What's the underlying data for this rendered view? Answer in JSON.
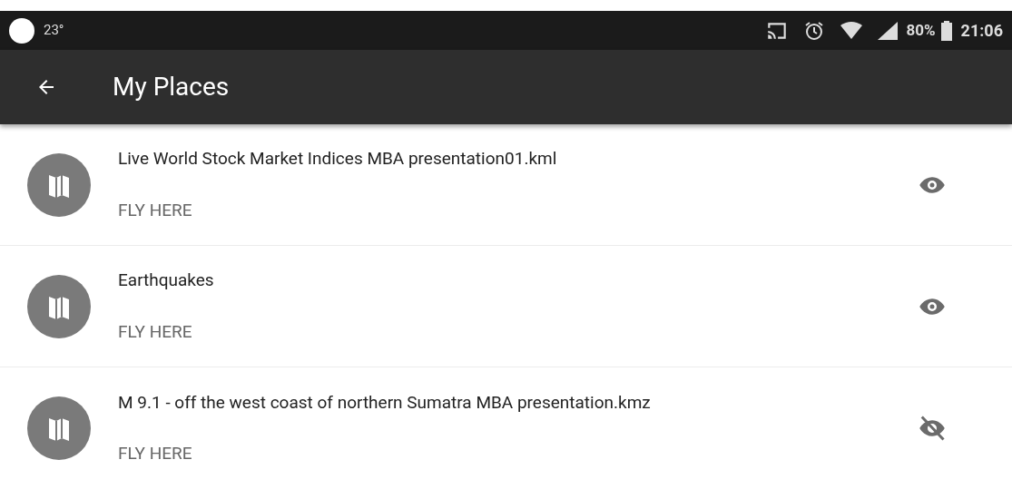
{
  "status_bar": {
    "temperature": "23°",
    "battery": "80%",
    "time": "21:06"
  },
  "app_bar": {
    "title": "My Places"
  },
  "places": [
    {
      "name": "Live World Stock Market Indices MBA presentation01.kml",
      "action": "FLY HERE",
      "visible": true
    },
    {
      "name": "Earthquakes",
      "action": "FLY HERE",
      "visible": true
    },
    {
      "name": "M 9.1 - off the west coast of northern Sumatra MBA presentation.kmz",
      "action": "FLY HERE",
      "visible": false
    }
  ]
}
